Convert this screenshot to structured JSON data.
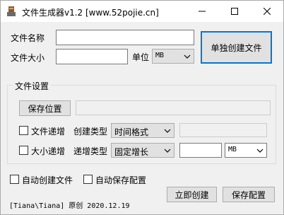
{
  "window": {
    "title": "文件生成器v1.2 [www.52pojie.cn]"
  },
  "form": {
    "file_name_label": "文件名称",
    "file_name_value": "",
    "file_size_label": "文件大小",
    "file_size_value": "",
    "unit_label": "单位",
    "unit_value": "MB",
    "create_single_button": "单独创建文件"
  },
  "settings": {
    "group_title": "文件设置",
    "save_location_button": "保存位置",
    "save_location_value": "",
    "increment_file_label": "文件递增",
    "create_type_label": "创建类型",
    "create_type_value": "时间格式",
    "create_type_extra_value": "",
    "increment_size_label": "大小递增",
    "increment_type_label": "递增类型",
    "increment_type_value": "固定增长",
    "increment_size_value": "",
    "increment_unit_value": "MB"
  },
  "options": {
    "auto_create_label": "自动创建文件",
    "auto_save_label": "自动保存配置"
  },
  "footer": {
    "credit": "[Tiana\\Tiana] 原创 2020.12.19",
    "create_now_button": "立即创建",
    "save_config_button": "保存配置"
  }
}
